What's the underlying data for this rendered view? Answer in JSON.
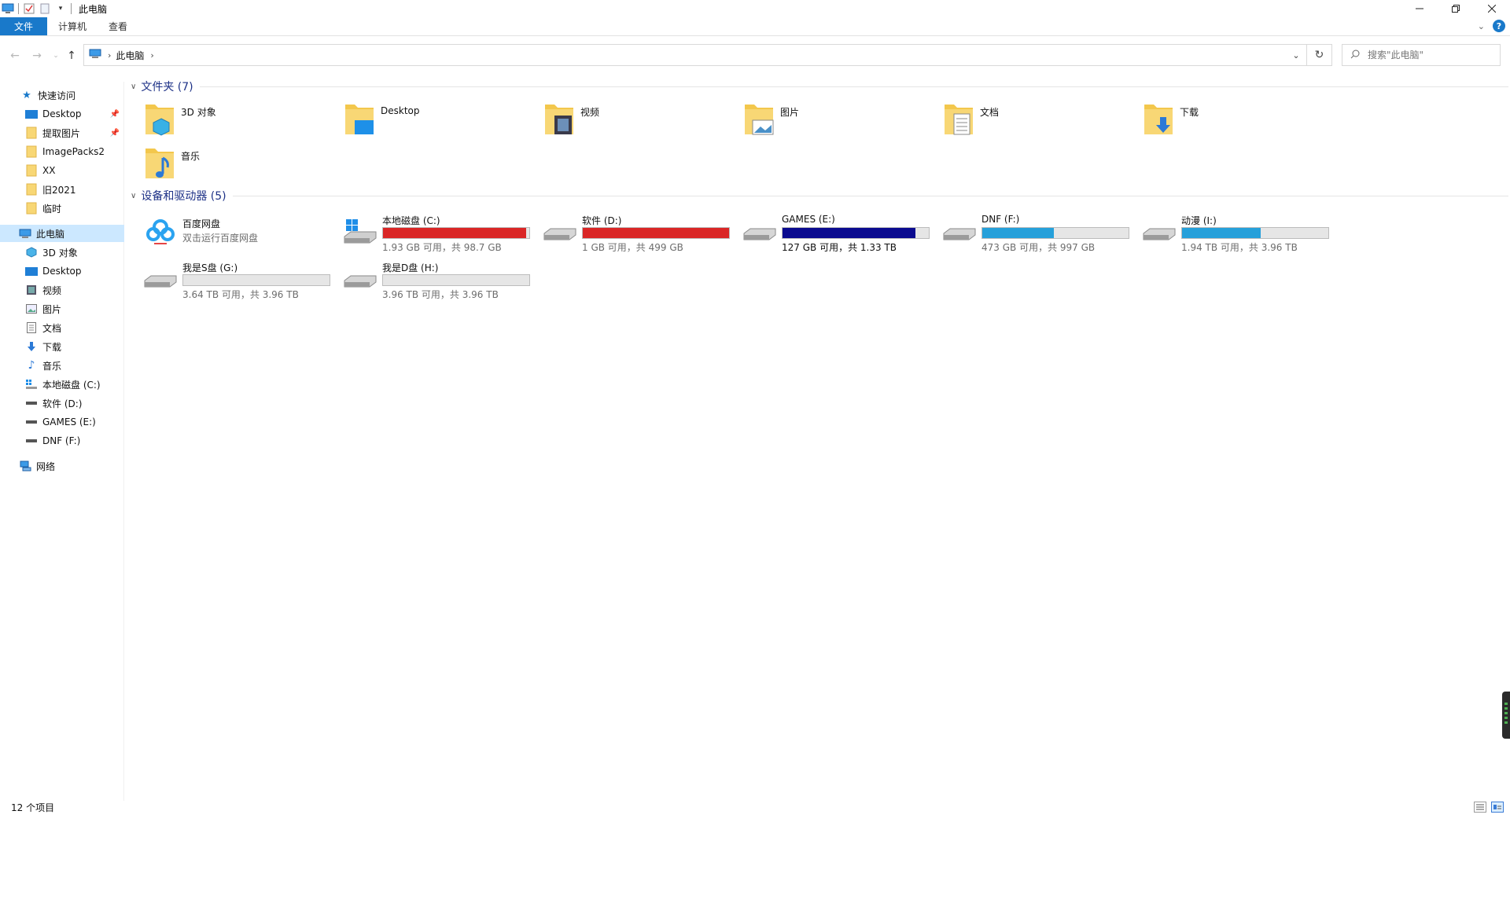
{
  "window": {
    "title": "此电脑"
  },
  "ribbon": {
    "tabs": [
      "文件",
      "计算机",
      "查看"
    ]
  },
  "address": {
    "crumbs": [
      "此电脑"
    ],
    "search_placeholder": "搜索\"此电脑\""
  },
  "sidebar": {
    "quick_access": "快速访问",
    "quick_items": [
      "Desktop",
      "提取图片",
      "ImagePacks2",
      "XX",
      "旧2021",
      "临时"
    ],
    "this_pc": "此电脑",
    "pc_items": [
      "3D 对象",
      "Desktop",
      "视频",
      "图片",
      "文档",
      "下载",
      "音乐",
      "本地磁盘 (C:)",
      "软件 (D:)",
      "GAMES (E:)",
      "DNF (F:)"
    ],
    "network": "网络"
  },
  "folders": {
    "header": "文件夹 (7)",
    "items": [
      "3D 对象",
      "Desktop",
      "视频",
      "图片",
      "文档",
      "下载",
      "音乐"
    ]
  },
  "devices": {
    "header": "设备和驱动器 (5)",
    "baidu": {
      "name": "百度网盘",
      "subtitle": "双击运行百度网盘"
    },
    "drives": [
      {
        "name": "本地磁盘 (C:)",
        "free": "1.93 GB 可用，共 98.7 GB",
        "used_fraction": 0.98,
        "color": "#da2626"
      },
      {
        "name": "软件 (D:)",
        "free": "1 GB 可用，共 499 GB",
        "used_fraction": 0.998,
        "color": "#da2626"
      },
      {
        "name": "GAMES (E:)",
        "free": "127 GB 可用，共 1.33 TB",
        "used_fraction": 0.91,
        "color": "#0a0a8f"
      },
      {
        "name": "DNF (F:)",
        "free": "473 GB 可用，共 997 GB",
        "used_fraction": 0.49,
        "color": "#26a0da"
      },
      {
        "name": "动漫 (I:)",
        "free": "1.94 TB 可用，共 3.96 TB",
        "used_fraction": 0.54,
        "color": "#26a0da"
      },
      {
        "name": "我是S盘 (G:)",
        "free": "3.64 TB 可用，共 3.96 TB",
        "used_fraction": 0.0,
        "color": "#26a0da"
      },
      {
        "name": "我是D盘 (H:)",
        "free": "3.96 TB 可用，共 3.96 TB",
        "used_fraction": 0.0,
        "color": "#26a0da"
      }
    ]
  },
  "status": {
    "count": "12 个项目"
  },
  "colors": {
    "accent": "#1979ca",
    "group_title": "#1e3287",
    "selected": "#cce8ff"
  }
}
